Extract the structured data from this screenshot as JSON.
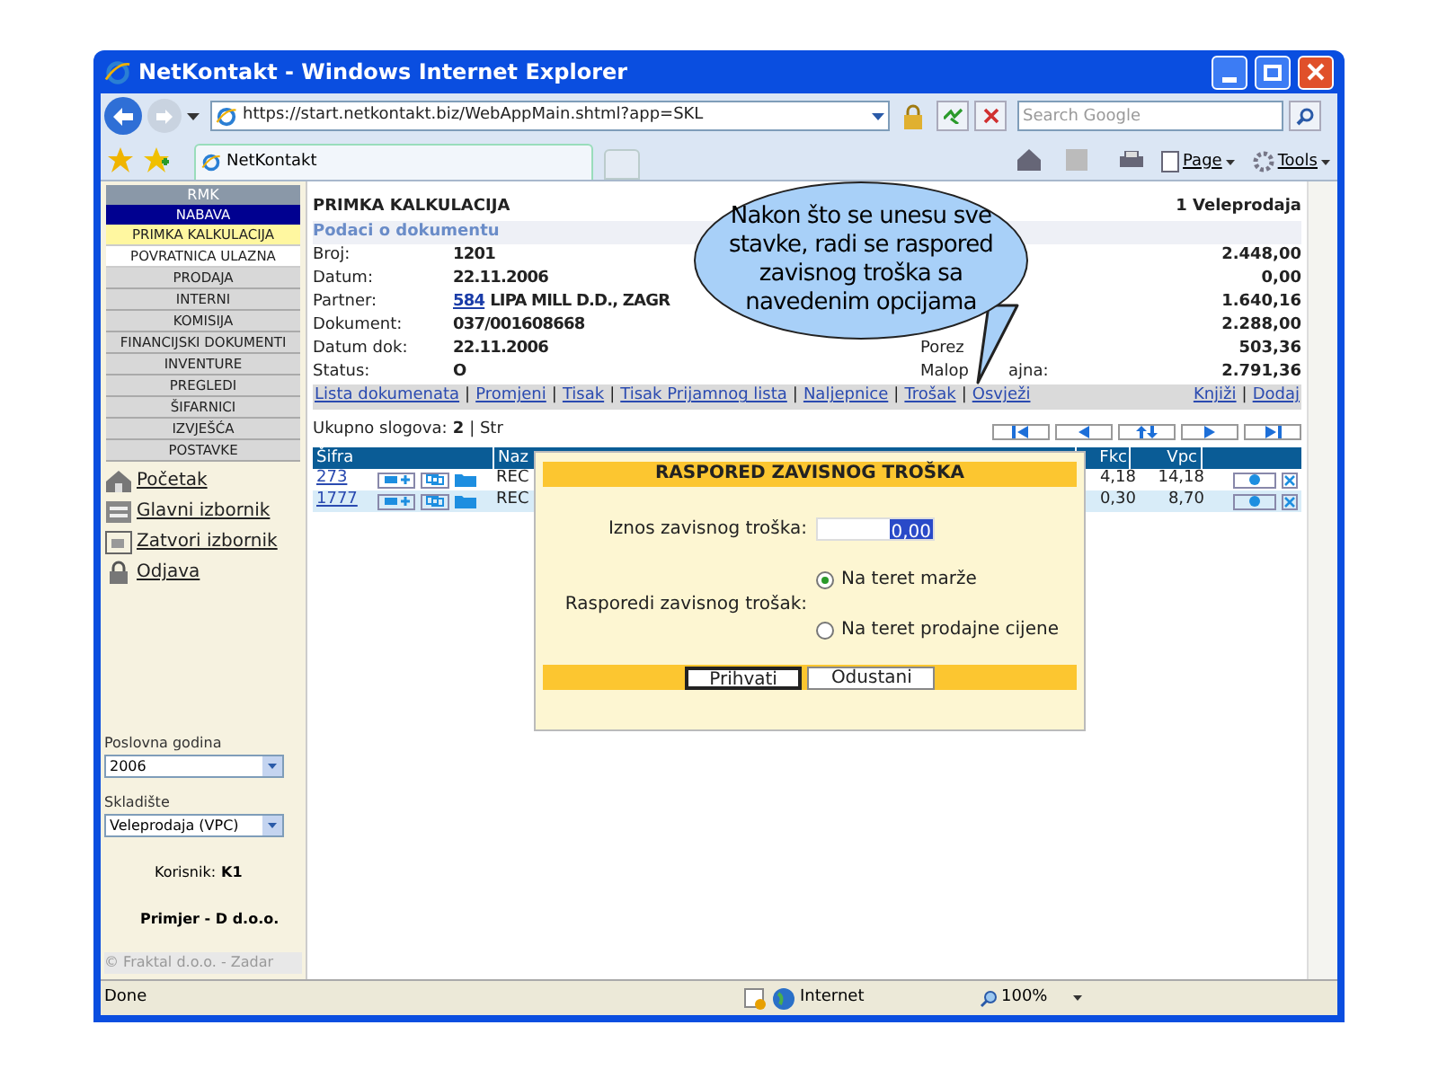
{
  "browser": {
    "title": "NetKontakt - Windows Internet Explorer",
    "url": "https://start.netkontakt.biz/WebAppMain.shtml?app=SKL",
    "search_placeholder": "Search Google",
    "tab": "NetKontakt",
    "tools": [
      "Page",
      "Tools"
    ],
    "status": "Done",
    "zone": "Internet",
    "zoom": "100%"
  },
  "sidebar": {
    "module": "RMK",
    "menu": [
      {
        "label": "NABAVA",
        "kind": "section",
        "selected": true
      },
      {
        "label": "PRIMKA KALKULACIJA",
        "kind": "sub",
        "selected": true
      },
      {
        "label": "POVRATNICA ULAZNA",
        "kind": "sub",
        "selected": false
      },
      {
        "label": "PRODAJA",
        "kind": "section",
        "selected": false
      },
      {
        "label": "INTERNI",
        "kind": "section",
        "selected": false
      },
      {
        "label": "KOMISIJA",
        "kind": "section",
        "selected": false
      },
      {
        "label": "FINANCIJSKI DOKUMENTI",
        "kind": "section",
        "selected": false
      },
      {
        "label": "INVENTURE",
        "kind": "section",
        "selected": false
      },
      {
        "label": "PREGLEDI",
        "kind": "section",
        "selected": false
      },
      {
        "label": "ŠIFARNICI",
        "kind": "section",
        "selected": false
      },
      {
        "label": "IZVJEŠĆA",
        "kind": "section",
        "selected": false
      },
      {
        "label": "POSTAVKE",
        "kind": "section",
        "selected": false
      }
    ],
    "links": [
      {
        "label": "Početak",
        "kind": "home"
      },
      {
        "label": "Glavni izbornik",
        "kind": "menu"
      },
      {
        "label": "Zatvori izbornik",
        "kind": "close"
      },
      {
        "label": "Odjava",
        "kind": "logout"
      }
    ],
    "year": {
      "label": "Poslovna godina",
      "value": "2006"
    },
    "warehouse": {
      "label": "Skladište",
      "value": "Veleprodaja (VPC)"
    },
    "user": {
      "label": "Korisnik:",
      "value": "K1"
    },
    "company": "Primjer - D d.o.o.",
    "copyright": "© Fraktal d.o.o. - Zadar"
  },
  "main": {
    "title": "PRIMKA KALKULACIJA",
    "title_right": "1 Veleprodaja",
    "section": "Podaci o dokumentu",
    "rows": [
      {
        "label": "Broj:",
        "value": "1201",
        "summary_value": "2.448,00"
      },
      {
        "label": "Datum:",
        "value": "22.11.2006",
        "summary_value": "0,00"
      },
      {
        "label": "Partner:",
        "code": "584",
        "value": "LIPA MILL D.D., ZAGR",
        "summary_value": "1.640,16"
      },
      {
        "label": "Dokument:",
        "value": "037/001608668",
        "summary_value": "2.288,00"
      },
      {
        "label": "Datum dok:",
        "value": "22.11.2006",
        "summary_label": "Porez",
        "summary_value": "503,36"
      },
      {
        "label": "Status:",
        "value": "O",
        "summary_label": "Malop",
        "summary_label_tail": "ajna:",
        "summary_value": "2.791,36"
      }
    ],
    "actions_left": [
      "Lista dokumenata",
      "Promjeni",
      "Tisak",
      "Tisak Prijamnog lista",
      "Naljepnice",
      "Trošak",
      "Osvježi"
    ],
    "actions_right": [
      "Knjiži",
      "Dodaj"
    ],
    "records_label": "Ukupno slogova:",
    "records_count": "2",
    "page_label": "| Str",
    "separator": "|",
    "columns": [
      "Šifra",
      "Naz",
      "Fkc",
      "Vpc"
    ],
    "table_rows": [
      {
        "code": "273",
        "name": "REC",
        "fkc": "4,18",
        "vpc": "14,18"
      },
      {
        "code": "1777",
        "name": "REC",
        "fkc": "0,30",
        "vpc": "8,70"
      }
    ]
  },
  "dialog": {
    "title": "RASPORED ZAVISNOG TROŠKA",
    "amount_label": "Iznos zavisnog troška:",
    "amount_value": "0,00",
    "radio_label": "Rasporedi zavisnog trošak:",
    "options": [
      {
        "label": "Na teret marže",
        "selected": true
      },
      {
        "label": "Na teret prodajne cijene",
        "selected": false
      }
    ],
    "buttons": [
      "Prihvati",
      "Odustani"
    ]
  },
  "callout": "Nakon što se unesu sve stavke, radi se raspored zavisnog troška sa navedenim opcijama"
}
